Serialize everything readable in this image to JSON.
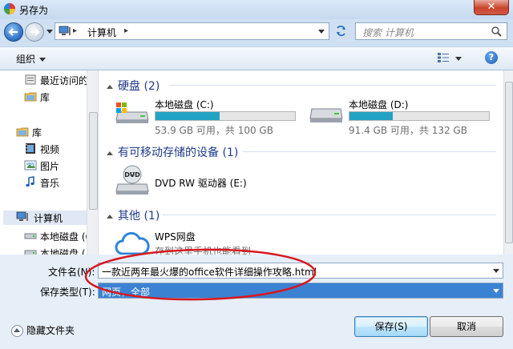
{
  "window": {
    "title": "另存为",
    "close_label": "✕"
  },
  "address": {
    "location": "计算机",
    "separator": "▸",
    "search_placeholder": "搜索 计算机"
  },
  "toolbar": {
    "organize_label": "组织",
    "help_label": "?"
  },
  "nav": {
    "items": [
      {
        "label": "最近访问的",
        "icon": "recent-places-icon"
      },
      {
        "label": "库",
        "icon": "library-icon"
      },
      {
        "label": "库",
        "icon": "library-icon"
      },
      {
        "label": "视频",
        "icon": "video-icon"
      },
      {
        "label": "图片",
        "icon": "pictures-icon"
      },
      {
        "label": "音乐",
        "icon": "music-icon"
      },
      {
        "label": "计算机",
        "icon": "computer-icon"
      },
      {
        "label": "本地磁盘 (C",
        "icon": "drive-icon"
      },
      {
        "label": "本地磁盘 (",
        "icon": "drive-icon"
      }
    ]
  },
  "groups": {
    "hard_disks": {
      "title": "硬盘 (2)"
    },
    "removable": {
      "title": "有可移动存储的设备 (1)"
    },
    "other": {
      "title": "其他 (1)"
    }
  },
  "drives": {
    "c": {
      "name": "本地磁盘 (C:)",
      "size": "53.9 GB 可用，共 100 GB",
      "used_fraction": 0.461
    },
    "d": {
      "name": "本地磁盘 (D:)",
      "size": "91.4 GB 可用，共 132 GB",
      "used_fraction": 0.308
    },
    "dvd": {
      "name": "DVD RW 驱动器 (E:)",
      "badge": "DVD"
    },
    "wps": {
      "name": "WPS网盘",
      "desc": "存到这里手机也能看到"
    }
  },
  "form": {
    "filename_label": "文件名(N):",
    "filename_value": "一款近两年最火爆的office软件详细操作攻略.html",
    "filetype_label": "保存类型(T):",
    "filetype_value": "网页，全部"
  },
  "footer": {
    "hide_folders_label": "隐藏文件夹",
    "save_label": "保存(S)",
    "cancel_label": "取消"
  },
  "colors": {
    "accent": "#3c82d2",
    "drive_fill": "#23a3c4",
    "annotation": "#d6181f",
    "group_text": "#1e3a8a"
  }
}
